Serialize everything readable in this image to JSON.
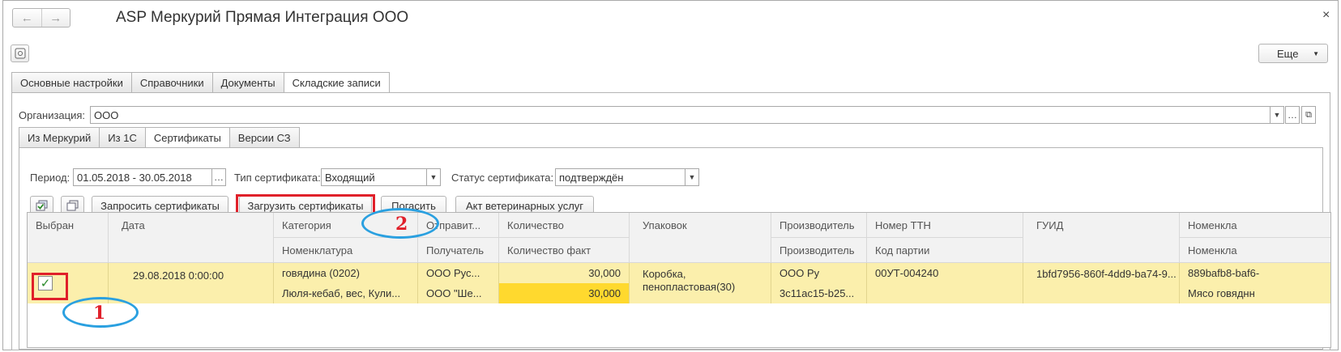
{
  "window": {
    "title": "ASP Меркурий Прямая Интеграция ООО",
    "more_label": "Еще",
    "close_glyph": "×",
    "back_glyph": "←",
    "forward_glyph": "→"
  },
  "main_tabs": [
    {
      "label": "Основные настройки"
    },
    {
      "label": "Справочники"
    },
    {
      "label": "Документы"
    },
    {
      "label": "Складские записи"
    }
  ],
  "organization": {
    "label": "Организация:",
    "value": "ООО"
  },
  "sub_tabs": [
    {
      "label": "Из Меркурий"
    },
    {
      "label": "Из 1С"
    },
    {
      "label": "Сертификаты"
    },
    {
      "label": "Версии СЗ"
    }
  ],
  "filters": {
    "period_label": "Период:",
    "period_value": "01.05.2018 - 30.05.2018",
    "cert_type_label": "Тип сертификата:",
    "cert_type_value": "Входящий",
    "cert_status_label": "Статус сертификата:",
    "cert_status_value": "подтверждён"
  },
  "toolbar": {
    "request_label": "Запросить сертификаты",
    "load_label": "Загрузить сертификаты",
    "redeem_label": "Погасить",
    "act_label": "Акт ветеринарных услуг"
  },
  "annotations": {
    "one": "1",
    "two": "2"
  },
  "table": {
    "headers": {
      "selected": "Выбран",
      "date": "Дата",
      "category": "Категория",
      "nomenclature": "Номенклатура",
      "sender": "Отправит...",
      "receiver": "Получатель",
      "quantity": "Количество",
      "quantity_fact": "Количество факт",
      "packages": "Упаковок",
      "producer": "Производитель",
      "producer2": "Производитель",
      "ttn": "Номер ТТН",
      "batch": "Код партии",
      "guid": "ГУИД",
      "nomenclature2": "Номенкла",
      "nomenclature3": "Номенкла"
    },
    "row": {
      "selected": true,
      "date": "29.08.2018 0:00:00",
      "category": "говядина (0202)",
      "nomenclature": "Люля-кебаб, вес, Кули...",
      "sender": "ООО Рус...",
      "receiver": "ООО \"Ше...",
      "quantity": "30,000",
      "quantity_fact": "30,000",
      "packages": "Коробка, пенопластовая(30)",
      "producer": "ООО Ру",
      "producer2": "3c11ac15-b25...",
      "ttn": "00УТ-004240",
      "batch": "",
      "guid": "1bfd7956-860f-4dd9-ba74-9...",
      "nomenclature2": "889bafb8-baf6-",
      "nomenclature3": "Мясо говяднн"
    }
  },
  "colors": {
    "row_bg": "#fbefac",
    "highlight_cell": "#ffd92e",
    "annotation_red": "#e0202a",
    "annotation_blue": "#2aa0e0"
  }
}
